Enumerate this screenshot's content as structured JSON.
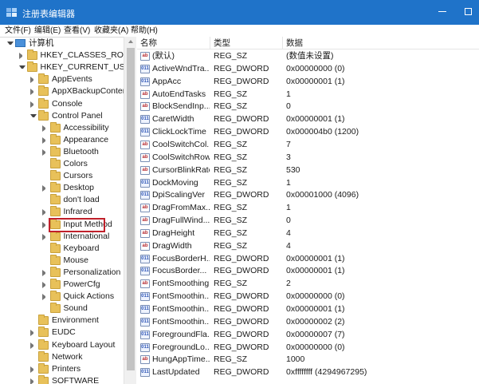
{
  "window": {
    "title": "注册表编辑器",
    "accent": "#1f73c9",
    "highlight_color": "#c0202a"
  },
  "menu": [
    "文件(F)",
    "编辑(E)",
    "查看(V)",
    "收藏夹(A)",
    "帮助(H)"
  ],
  "tree": [
    {
      "label": "计算机",
      "expander": "down",
      "icon": "computer-icon"
    },
    {
      "label": "HKEY_CLASSES_ROOT",
      "expander": "right",
      "icon": "folder-icon"
    },
    {
      "label": "HKEY_CURRENT_USER",
      "expander": "down",
      "icon": "folder-icon"
    },
    {
      "label": "AppEvents",
      "expander": "right",
      "icon": "folder-icon"
    },
    {
      "label": "AppXBackupConter",
      "expander": "right",
      "icon": "folder-icon"
    },
    {
      "label": "Console",
      "expander": "right",
      "icon": "folder-icon"
    },
    {
      "label": "Control Panel",
      "expander": "down",
      "icon": "folder-icon"
    },
    {
      "label": "Accessibility",
      "expander": "right",
      "icon": "folder-icon"
    },
    {
      "label": "Appearance",
      "expander": "right",
      "icon": "folder-icon"
    },
    {
      "label": "Bluetooth",
      "expander": "right",
      "icon": "folder-icon"
    },
    {
      "label": "Colors",
      "expander": "none",
      "icon": "folder-icon"
    },
    {
      "label": "Cursors",
      "expander": "none",
      "icon": "folder-icon"
    },
    {
      "label": "Desktop",
      "expander": "right",
      "icon": "folder-icon",
      "selected": true
    },
    {
      "label": "don't load",
      "expander": "none",
      "icon": "folder-icon"
    },
    {
      "label": "Infrared",
      "expander": "right",
      "icon": "folder-icon"
    },
    {
      "label": "Input Method",
      "expander": "right",
      "icon": "folder-icon"
    },
    {
      "label": "International",
      "expander": "right",
      "icon": "folder-icon"
    },
    {
      "label": "Keyboard",
      "expander": "none",
      "icon": "folder-icon"
    },
    {
      "label": "Mouse",
      "expander": "none",
      "icon": "folder-icon"
    },
    {
      "label": "Personalization",
      "expander": "right",
      "icon": "folder-icon"
    },
    {
      "label": "PowerCfg",
      "expander": "right",
      "icon": "folder-icon"
    },
    {
      "label": "Quick Actions",
      "expander": "right",
      "icon": "folder-icon"
    },
    {
      "label": "Sound",
      "expander": "none",
      "icon": "folder-icon"
    },
    {
      "label": "Environment",
      "expander": "none",
      "icon": "folder-icon"
    },
    {
      "label": "EUDC",
      "expander": "right",
      "icon": "folder-icon"
    },
    {
      "label": "Keyboard Layout",
      "expander": "right",
      "icon": "folder-icon"
    },
    {
      "label": "Network",
      "expander": "none",
      "icon": "folder-icon"
    },
    {
      "label": "Printers",
      "expander": "right",
      "icon": "folder-icon"
    },
    {
      "label": "SOFTWARE",
      "expander": "right",
      "icon": "folder-icon"
    }
  ],
  "list": {
    "headers": [
      "名称",
      "类型",
      "数据"
    ],
    "rows": [
      {
        "kind": "sz",
        "name": "(默认)",
        "type": "REG_SZ",
        "data": "(数值未设置)"
      },
      {
        "kind": "bin",
        "name": "ActiveWndTra...",
        "type": "REG_DWORD",
        "data": "0x00000000 (0)"
      },
      {
        "kind": "bin",
        "name": "AppAcc",
        "type": "REG_DWORD",
        "data": "0x00000001 (1)"
      },
      {
        "kind": "sz",
        "name": "AutoEndTasks",
        "type": "REG_SZ",
        "data": "1"
      },
      {
        "kind": "sz",
        "name": "BlockSendInp...",
        "type": "REG_SZ",
        "data": "0"
      },
      {
        "kind": "bin",
        "name": "CaretWidth",
        "type": "REG_DWORD",
        "data": "0x00000001 (1)"
      },
      {
        "kind": "bin",
        "name": "ClickLockTime",
        "type": "REG_DWORD",
        "data": "0x000004b0 (1200)"
      },
      {
        "kind": "sz",
        "name": "CoolSwitchCol...",
        "type": "REG_SZ",
        "data": "7"
      },
      {
        "kind": "sz",
        "name": "CoolSwitchRows",
        "type": "REG_SZ",
        "data": "3"
      },
      {
        "kind": "sz",
        "name": "CursorBlinkRate",
        "type": "REG_SZ",
        "data": "530"
      },
      {
        "kind": "bin",
        "name": "DockMoving",
        "type": "REG_SZ",
        "data": "1"
      },
      {
        "kind": "bin",
        "name": "DpiScalingVer",
        "type": "REG_DWORD",
        "data": "0x00001000 (4096)"
      },
      {
        "kind": "sz",
        "name": "DragFromMax...",
        "type": "REG_SZ",
        "data": "1"
      },
      {
        "kind": "sz",
        "name": "DragFullWind...",
        "type": "REG_SZ",
        "data": "0"
      },
      {
        "kind": "sz",
        "name": "DragHeight",
        "type": "REG_SZ",
        "data": "4"
      },
      {
        "kind": "sz",
        "name": "DragWidth",
        "type": "REG_SZ",
        "data": "4"
      },
      {
        "kind": "bin",
        "name": "FocusBorderH...",
        "type": "REG_DWORD",
        "data": "0x00000001 (1)"
      },
      {
        "kind": "bin",
        "name": "FocusBorder...",
        "type": "REG_DWORD",
        "data": "0x00000001 (1)"
      },
      {
        "kind": "sz",
        "name": "FontSmoothing",
        "type": "REG_SZ",
        "data": "2"
      },
      {
        "kind": "bin",
        "name": "FontSmoothin...",
        "type": "REG_DWORD",
        "data": "0x00000000 (0)"
      },
      {
        "kind": "bin",
        "name": "FontSmoothin...",
        "type": "REG_DWORD",
        "data": "0x00000001 (1)"
      },
      {
        "kind": "bin",
        "name": "FontSmoothin...",
        "type": "REG_DWORD",
        "data": "0x00000002 (2)"
      },
      {
        "kind": "bin",
        "name": "ForegroundFla...",
        "type": "REG_DWORD",
        "data": "0x00000007 (7)"
      },
      {
        "kind": "bin",
        "name": "ForegroundLo...",
        "type": "REG_DWORD",
        "data": "0x00000000 (0)"
      },
      {
        "kind": "sz",
        "name": "HungAppTime...",
        "type": "REG_SZ",
        "data": "1000"
      },
      {
        "kind": "bin",
        "name": "LastUpdated",
        "type": "REG_DWORD",
        "data": "0xffffffff (4294967295)"
      }
    ]
  }
}
